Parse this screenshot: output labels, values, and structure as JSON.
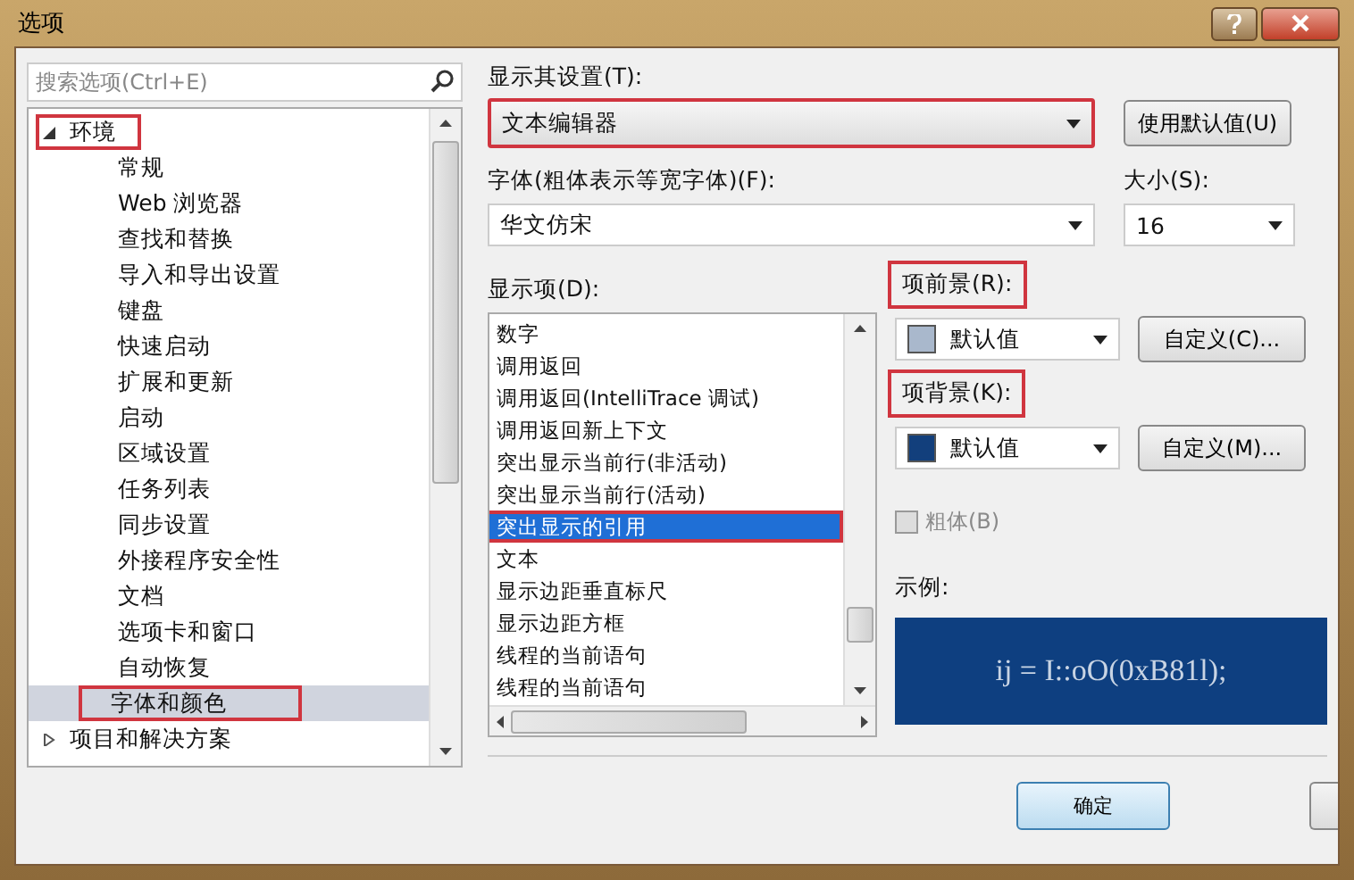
{
  "window": {
    "title": "选项"
  },
  "search": {
    "placeholder": "搜索选项(Ctrl+E)"
  },
  "tree": [
    {
      "label": "环境",
      "expanded": true,
      "selected": false,
      "highlighted": true,
      "children": [
        {
          "label": "常规",
          "selected": false,
          "highlighted": false
        },
        {
          "label": "Web 浏览器",
          "selected": false,
          "highlighted": false
        },
        {
          "label": "查找和替换",
          "selected": false,
          "highlighted": false
        },
        {
          "label": "导入和导出设置",
          "selected": false,
          "highlighted": false
        },
        {
          "label": "键盘",
          "selected": false,
          "highlighted": false
        },
        {
          "label": "快速启动",
          "selected": false,
          "highlighted": false
        },
        {
          "label": "扩展和更新",
          "selected": false,
          "highlighted": false
        },
        {
          "label": "启动",
          "selected": false,
          "highlighted": false
        },
        {
          "label": "区域设置",
          "selected": false,
          "highlighted": false
        },
        {
          "label": "任务列表",
          "selected": false,
          "highlighted": false
        },
        {
          "label": "同步设置",
          "selected": false,
          "highlighted": false
        },
        {
          "label": "外接程序安全性",
          "selected": false,
          "highlighted": false
        },
        {
          "label": "文档",
          "selected": false,
          "highlighted": false
        },
        {
          "label": "选项卡和窗口",
          "selected": false,
          "highlighted": false
        },
        {
          "label": "自动恢复",
          "selected": false,
          "highlighted": false
        },
        {
          "label": "字体和颜色",
          "selected": true,
          "highlighted": true
        }
      ]
    },
    {
      "label": "项目和解决方案",
      "expanded": false,
      "selected": false,
      "highlighted": false
    }
  ],
  "show_settings_for": {
    "label": "显示其设置(T):",
    "value": "文本编辑器",
    "highlighted": true
  },
  "use_defaults_button": "使用默认值(U)",
  "font": {
    "label": "字体(粗体表示等宽字体)(F):",
    "value": "华文仿宋"
  },
  "size": {
    "label": "大小(S):",
    "value": "16"
  },
  "display_items": {
    "label": "显示项(D):",
    "items": [
      {
        "label": "数字",
        "selected": false,
        "highlighted": false
      },
      {
        "label": "调用返回",
        "selected": false,
        "highlighted": false
      },
      {
        "label": "调用返回(IntelliTrace 调试)",
        "selected": false,
        "highlighted": false
      },
      {
        "label": "调用返回新上下文",
        "selected": false,
        "highlighted": false
      },
      {
        "label": "突出显示当前行(非活动)",
        "selected": false,
        "highlighted": false
      },
      {
        "label": "突出显示当前行(活动)",
        "selected": false,
        "highlighted": false
      },
      {
        "label": "突出显示的引用",
        "selected": true,
        "highlighted": true
      },
      {
        "label": "文本",
        "selected": false,
        "highlighted": false
      },
      {
        "label": "显示边距垂直标尺",
        "selected": false,
        "highlighted": false
      },
      {
        "label": "显示边距方框",
        "selected": false,
        "highlighted": false
      },
      {
        "label": "线程的当前语句",
        "selected": false,
        "highlighted": false
      },
      {
        "label": "线程的当前语句",
        "selected": false,
        "highlighted": false
      }
    ]
  },
  "foreground": {
    "label": "项前景(R):",
    "value": "默认值",
    "color": "#a9b8cc",
    "button": "自定义(C)...",
    "highlighted": true
  },
  "background": {
    "label": "项背景(K):",
    "value": "默认值",
    "color": "#123f7c",
    "button": "自定义(M)...",
    "highlighted": true
  },
  "bold": {
    "label": "粗体(B)",
    "checked": false,
    "disabled": true
  },
  "sample": {
    "label": "示例:",
    "text": "ij = I::oO(0xB81l);"
  },
  "ok_button": "确定"
}
